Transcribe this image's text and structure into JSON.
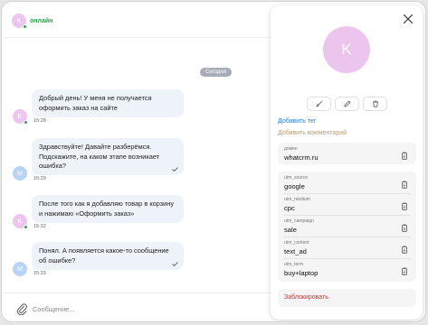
{
  "chat": {
    "header_avatar_letter": "K",
    "status": "онлайн",
    "date": "Сегодня",
    "composer_placeholder": "Сообщение...",
    "messages": [
      {
        "text": "Добрый день! У меня не получается оформить заказ на сайте",
        "time": "15:28",
        "avatar_letter": "K",
        "sender": "client"
      },
      {
        "text": "Здравствуйте! Давайте разберёмся. Подскажите, на каком этапе возникает ошибка?",
        "time": "15:29",
        "avatar_letter": "M",
        "sender": "manager"
      },
      {
        "text": "После того как я добавляю товар в корзину и нажимаю «Оформить заказ»",
        "time": "15:32",
        "avatar_letter": "K",
        "sender": "client"
      },
      {
        "text": "Понял. А появляется какое-то сообщение об ошибке?",
        "time": "15:33",
        "avatar_letter": "M",
        "sender": "manager"
      }
    ]
  },
  "panel": {
    "avatar_letter": "K",
    "add_tag": "Добавить тег",
    "add_comment": "Добавить комментарий",
    "domain": {
      "label": "домен",
      "value": "whatcrm.ru"
    },
    "utm_fields": [
      {
        "label": "utm_source",
        "value": "google"
      },
      {
        "label": "utm_medium",
        "value": "cpc"
      },
      {
        "label": "utm_campaign",
        "value": "sale"
      },
      {
        "label": "utm_content",
        "value": "text_ad"
      },
      {
        "label": "utm_term",
        "value": "buy+laptop"
      }
    ],
    "block": "Заблокировать"
  },
  "colors": {
    "online": "#2f9a4a",
    "link": "#2f7fd1",
    "comment_link": "#b59a7a",
    "danger": "#d62d2d",
    "bubble": "#eef3f9",
    "client_avatar": "#ebc5ee",
    "manager_avatar": "#b8d3f3"
  }
}
